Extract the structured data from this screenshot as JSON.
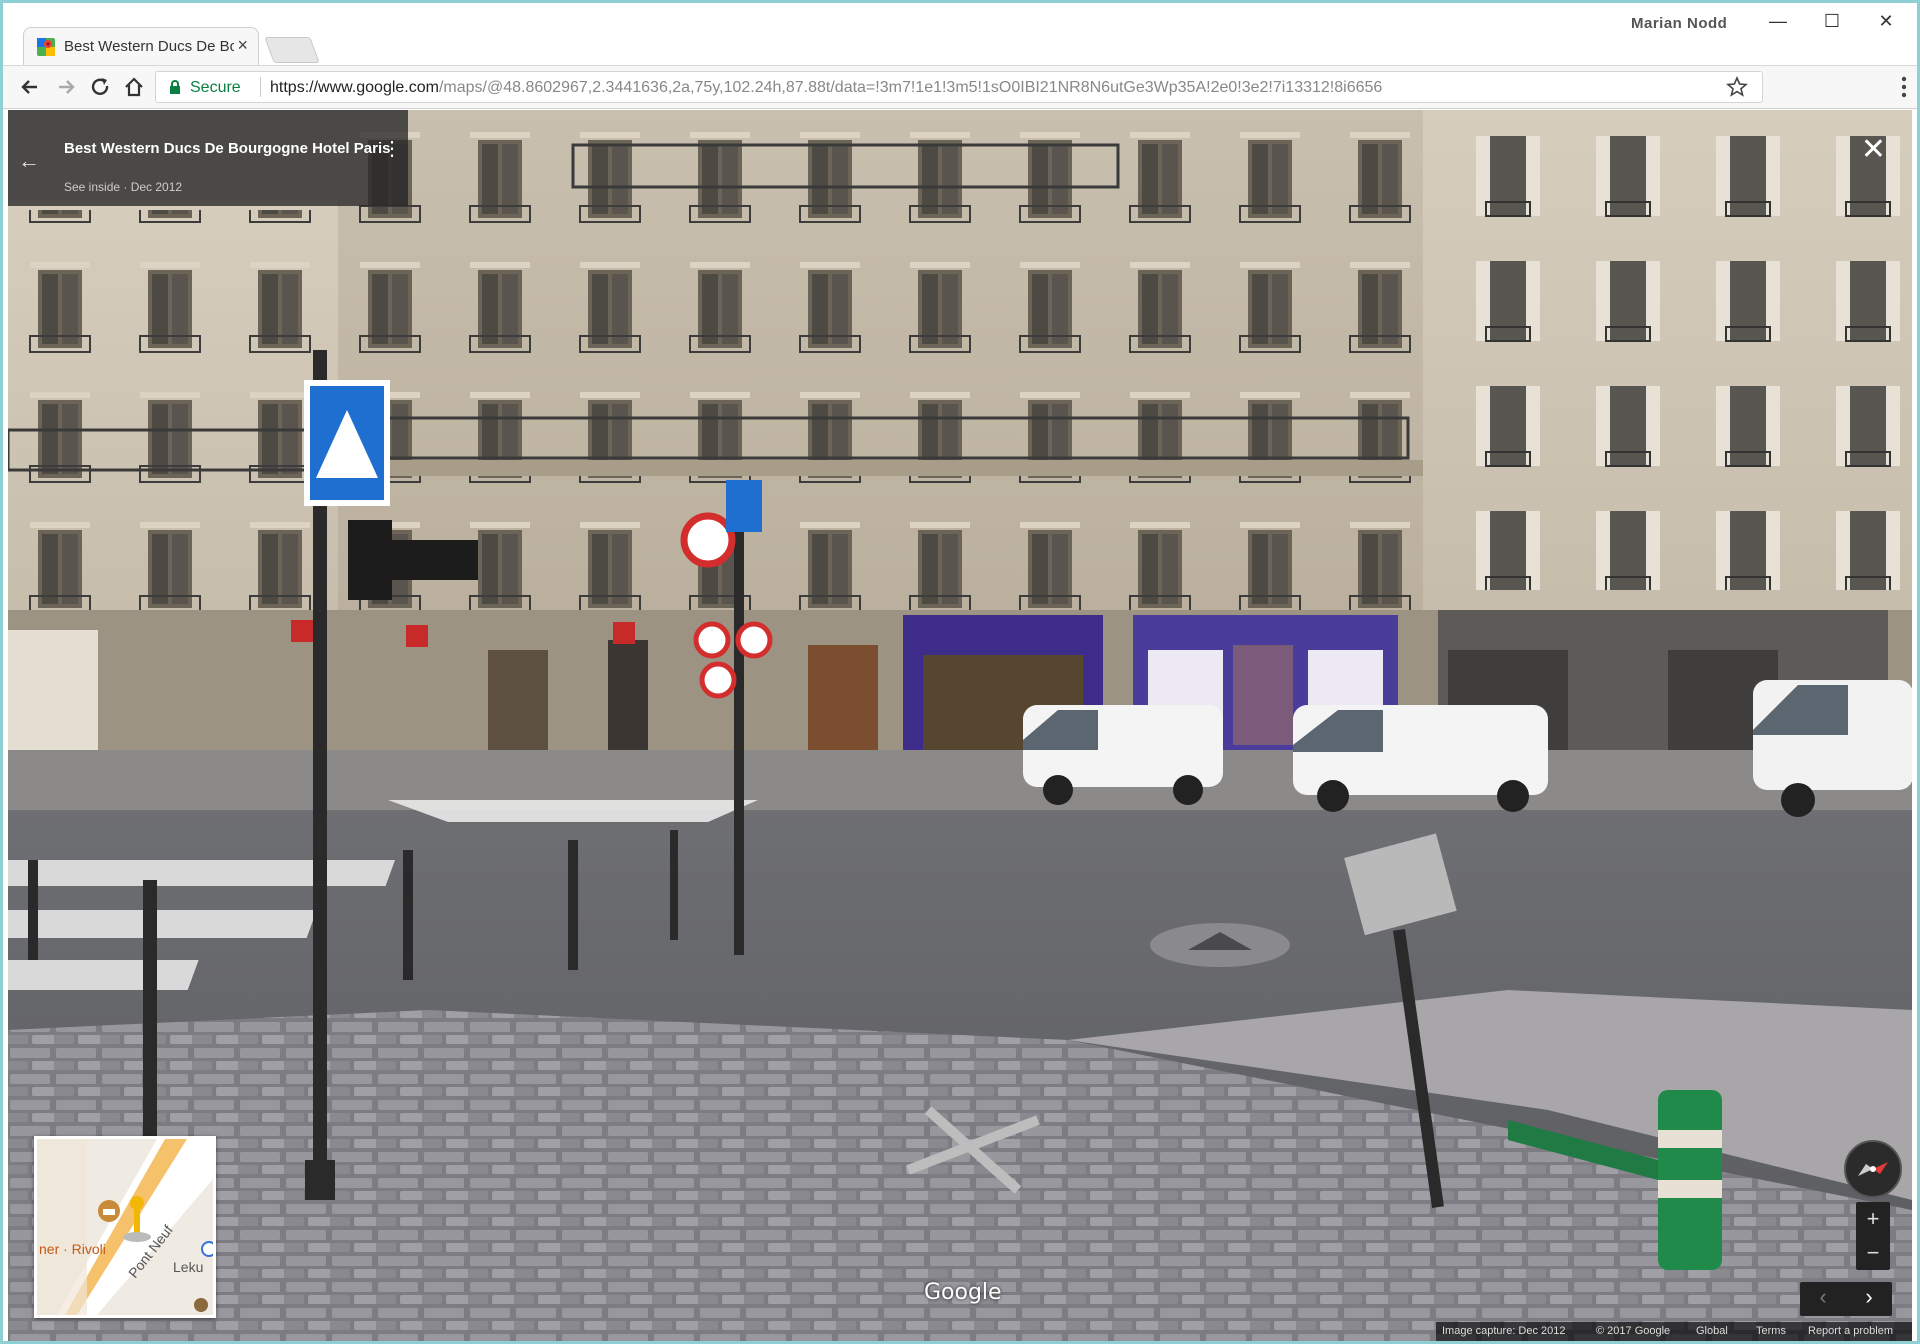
{
  "browser": {
    "tab_title": "Best Western Ducs De Bourgogne Hotel Paris - Google Maps",
    "profile_name": "Marian Nodd",
    "window_controls": {
      "minimize": "—",
      "maximize": "☐",
      "close": "✕"
    },
    "secure_label": "Secure",
    "url_host": "https://www.google.com",
    "url_path": "/maps/@48.8602967,2.3441636,2a,75y,102.24h,87.88t/data=!3m7!1e1!3m5!1sO0IBI21NR8N6utGe3Wp35A!2e0!3e2!7i13312!8i6656",
    "icons": [
      "back-icon",
      "forward-icon",
      "reload-icon",
      "home-icon",
      "lock-icon",
      "star-icon",
      "menu-icon"
    ]
  },
  "street_view": {
    "place_title": "Best Western Ducs De Bourgogne Hotel Paris",
    "place_subtitle": "See inside · Dec 2012",
    "back_glyph": "←",
    "menu_glyph": "⋮",
    "close_glyph": "✕",
    "minimap": {
      "label_rivoli": "ner · Rivoli",
      "label_pont": "Pont Neuf",
      "label_leku": "Leku"
    },
    "google_logo": "Google",
    "zoom_in": "+",
    "zoom_out": "−",
    "prev": "‹",
    "next": "›",
    "footer": {
      "capture": "Image capture: Dec 2012",
      "copyright": "© 2017 Google",
      "global": "Global",
      "terms": "Terms",
      "report": "Report a problem"
    }
  },
  "colors": {
    "window_border": "#8fd0d4",
    "secure_green": "#0b8043",
    "shop_purple": "#3d2c8a",
    "sign_blue": "#1f6fd0",
    "sign_red": "#d42d2d",
    "bollard_green": "#1f8a4a"
  }
}
